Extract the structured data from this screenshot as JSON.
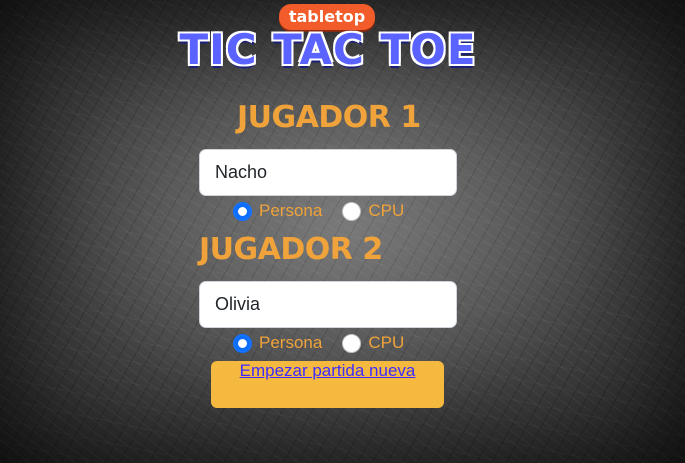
{
  "logo": {
    "small_text": "tabletop",
    "main_text": "TIC TAC TOE"
  },
  "player1": {
    "heading": "JUGADOR 1",
    "name_value": "Nacho",
    "options": [
      "Persona",
      "CPU"
    ],
    "selected": "Persona"
  },
  "player2": {
    "heading": "JUGADOR 2",
    "name_value": "Olivia",
    "options": [
      "Persona",
      "CPU"
    ],
    "selected": "Persona"
  },
  "start_button": {
    "label": "Empezar partida nueva"
  },
  "colors": {
    "heading": "#f0a33a",
    "button_bg": "#f5b940",
    "radio_selected": "#0d6efd"
  }
}
